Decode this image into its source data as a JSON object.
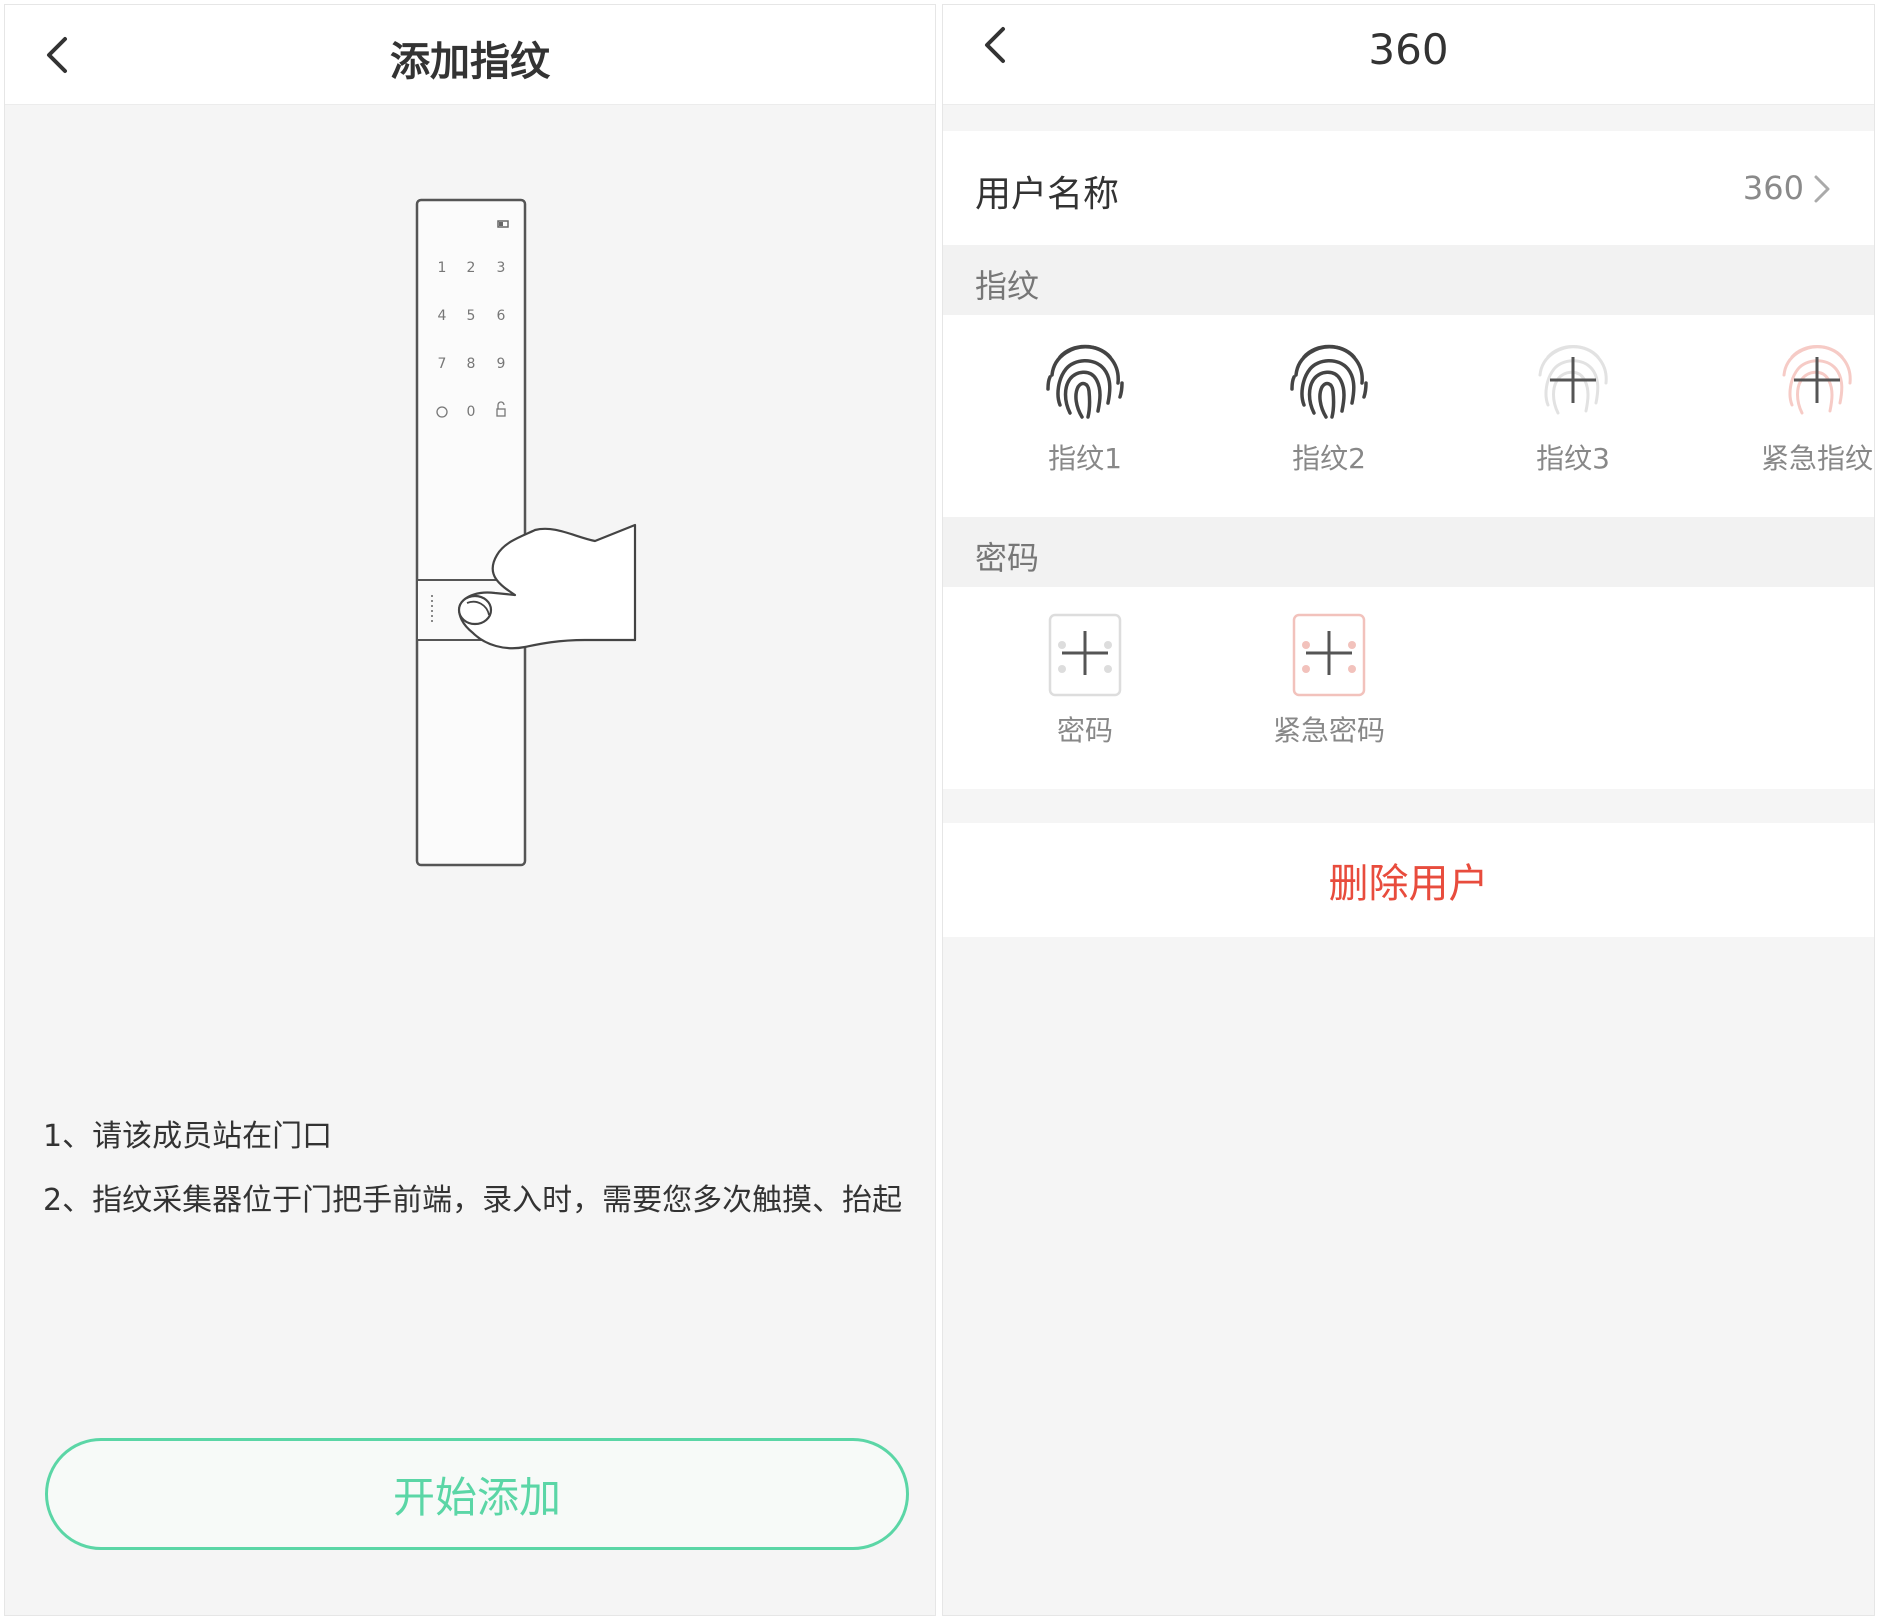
{
  "left": {
    "title": "添加指纹",
    "keypad": [
      "1",
      "2",
      "3",
      "4",
      "5",
      "6",
      "7",
      "8",
      "9",
      "0"
    ],
    "instructions": [
      "1、请该成员站在门口",
      "2、指纹采集器位于门把手前端，录入时，需要您多次触摸、抬起"
    ],
    "start_button": "开始添加"
  },
  "right": {
    "title": "360",
    "username_label": "用户名称",
    "username_value": "360",
    "fingerprint_section": "指纹",
    "fingerprints": [
      {
        "label": "指纹1",
        "state": "set"
      },
      {
        "label": "指纹2",
        "state": "set"
      },
      {
        "label": "指纹3",
        "state": "empty"
      },
      {
        "label": "紧急指纹",
        "state": "empty-emergency"
      }
    ],
    "password_section": "密码",
    "passwords": [
      {
        "label": "密码",
        "state": "empty"
      },
      {
        "label": "紧急密码",
        "state": "empty-emergency"
      }
    ],
    "delete_button": "删除用户"
  },
  "colors": {
    "accent_green": "#5bd6a6",
    "danger_red": "#e84c3d",
    "emergency_pink": "#f0a7a0"
  }
}
